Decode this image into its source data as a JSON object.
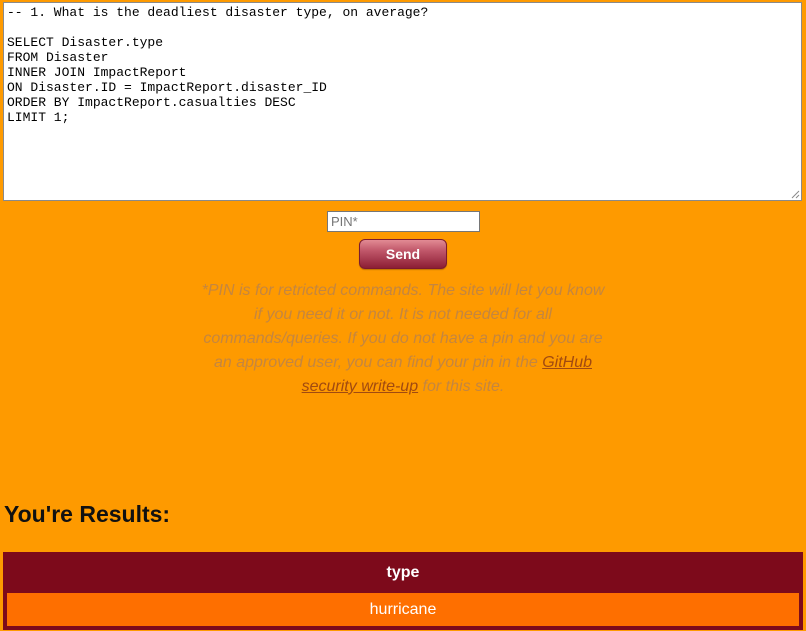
{
  "query_editor": {
    "text": "-- 1. What is the deadliest disaster type, on average?\n\nSELECT Disaster.type\nFROM Disaster\nINNER JOIN ImpactReport\nON Disaster.ID = ImpactReport.disaster_ID\nORDER BY ImpactReport.casualties DESC\nLIMIT 1;"
  },
  "pin": {
    "placeholder": "PIN*",
    "value": ""
  },
  "send_button": {
    "label": "Send"
  },
  "pin_note": {
    "text_before_link": "*PIN is for retricted commands. The site will let you know if you need it or not. It is not needed for all commands/queries. If you do not have a pin and you are an approved user, you can find your pin in the ",
    "link_text": "GitHub security write-up",
    "text_after_link": " for this site."
  },
  "results": {
    "heading": "You're Results:",
    "columns": [
      "type"
    ],
    "rows": [
      [
        "hurricane"
      ]
    ]
  },
  "colors": {
    "page_background": "#fe9a00",
    "table_background": "#7d0a1b",
    "row_background": "#fe6f00",
    "button_color": "#8c1e34"
  }
}
